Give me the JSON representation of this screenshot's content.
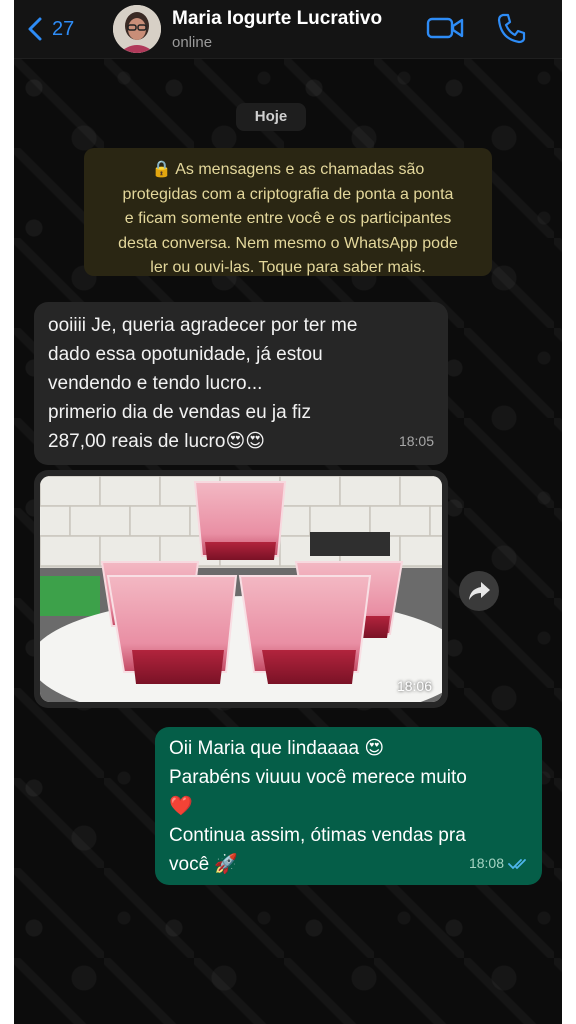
{
  "header": {
    "back_count": "27",
    "contact_name": "Maria Iogurte Lucrativo",
    "status": "online",
    "icons": {
      "back": "chevron-left-icon",
      "video": "video-camera-icon",
      "call": "phone-icon"
    },
    "accent_color": "#2e8cf6"
  },
  "chat": {
    "day_label": "Hoje",
    "encryption_notice": {
      "lines": [
        "🔒 As mensagens e as chamadas são",
        "protegidas com a criptografia de ponta a ponta",
        "e ficam somente entre você e os participantes",
        "desta conversa. Nem mesmo o WhatsApp pode",
        "ler ou ouvi-las. Toque para saber mais."
      ],
      "color": "#e3d79b"
    },
    "messages": [
      {
        "direction": "incoming",
        "lines": [
          "ooiiii Je, queria agradecer por ter me",
          "dado essa opotunidade, já estou",
          "vendendo e tendo lucro...",
          "primerio dia de vendas eu ja fiz",
          "287,00 reais de lucro😍😍"
        ],
        "time": "18:05"
      },
      {
        "direction": "incoming",
        "type": "image",
        "image_subject": "pink yogurt cups on a white plate",
        "time": "18:06"
      },
      {
        "direction": "outgoing",
        "lines": [
          "Oii Maria que lindaaaa 😍",
          "Parabéns viuuu você merece muito",
          "❤️",
          "Continua assim, ótimas vendas pra",
          "você 🚀"
        ],
        "time": "18:08",
        "status": "read",
        "status_icon": "double-check-icon"
      }
    ],
    "colors": {
      "incoming_bubble": "#262626",
      "outgoing_bubble": "#055e48",
      "read_ticks": "#4fb6ec"
    }
  }
}
